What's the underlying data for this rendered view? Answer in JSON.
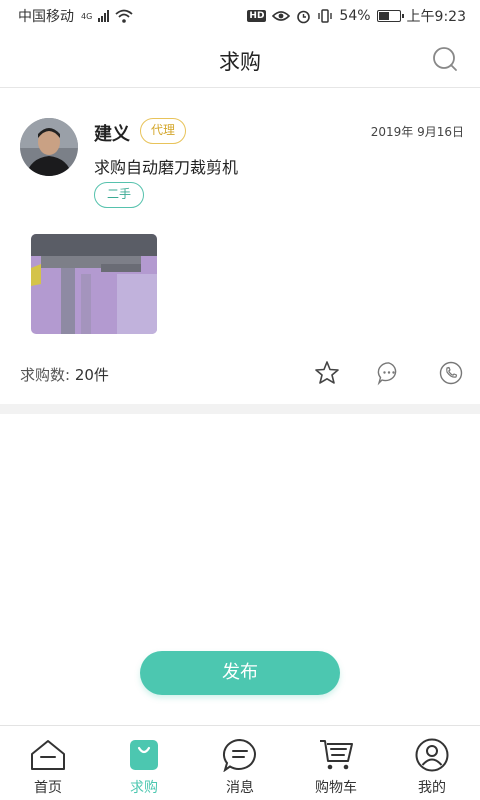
{
  "status_bar": {
    "carrier": "中国移动",
    "network": "4G",
    "hd": "HD",
    "battery_percent": "54%",
    "battery_level": 0.54,
    "time": "上午9:23"
  },
  "header": {
    "title": "求购",
    "search_icon": "search-icon"
  },
  "post": {
    "user_name": "建义",
    "role_tag": "代理",
    "date": "2019年 9月16日",
    "text": "求购自动磨刀裁剪机",
    "condition_tag": "二手",
    "quantity_label": "求购数:",
    "quantity_value": "20件",
    "actions": [
      "star-icon",
      "chat-icon",
      "phone-icon"
    ]
  },
  "publish_button": "发布",
  "tabs": [
    {
      "label": "首页",
      "icon": "home-icon",
      "active": false
    },
    {
      "label": "求购",
      "icon": "shopping-bag-icon",
      "active": true
    },
    {
      "label": "消息",
      "icon": "message-icon",
      "active": false
    },
    {
      "label": "购物车",
      "icon": "cart-icon",
      "active": false
    },
    {
      "label": "我的",
      "icon": "profile-icon",
      "active": false
    }
  ],
  "colors": {
    "accent": "#4cc7b0",
    "role_tag": "#d4a72c",
    "condition_tag": "#3aaa93"
  }
}
